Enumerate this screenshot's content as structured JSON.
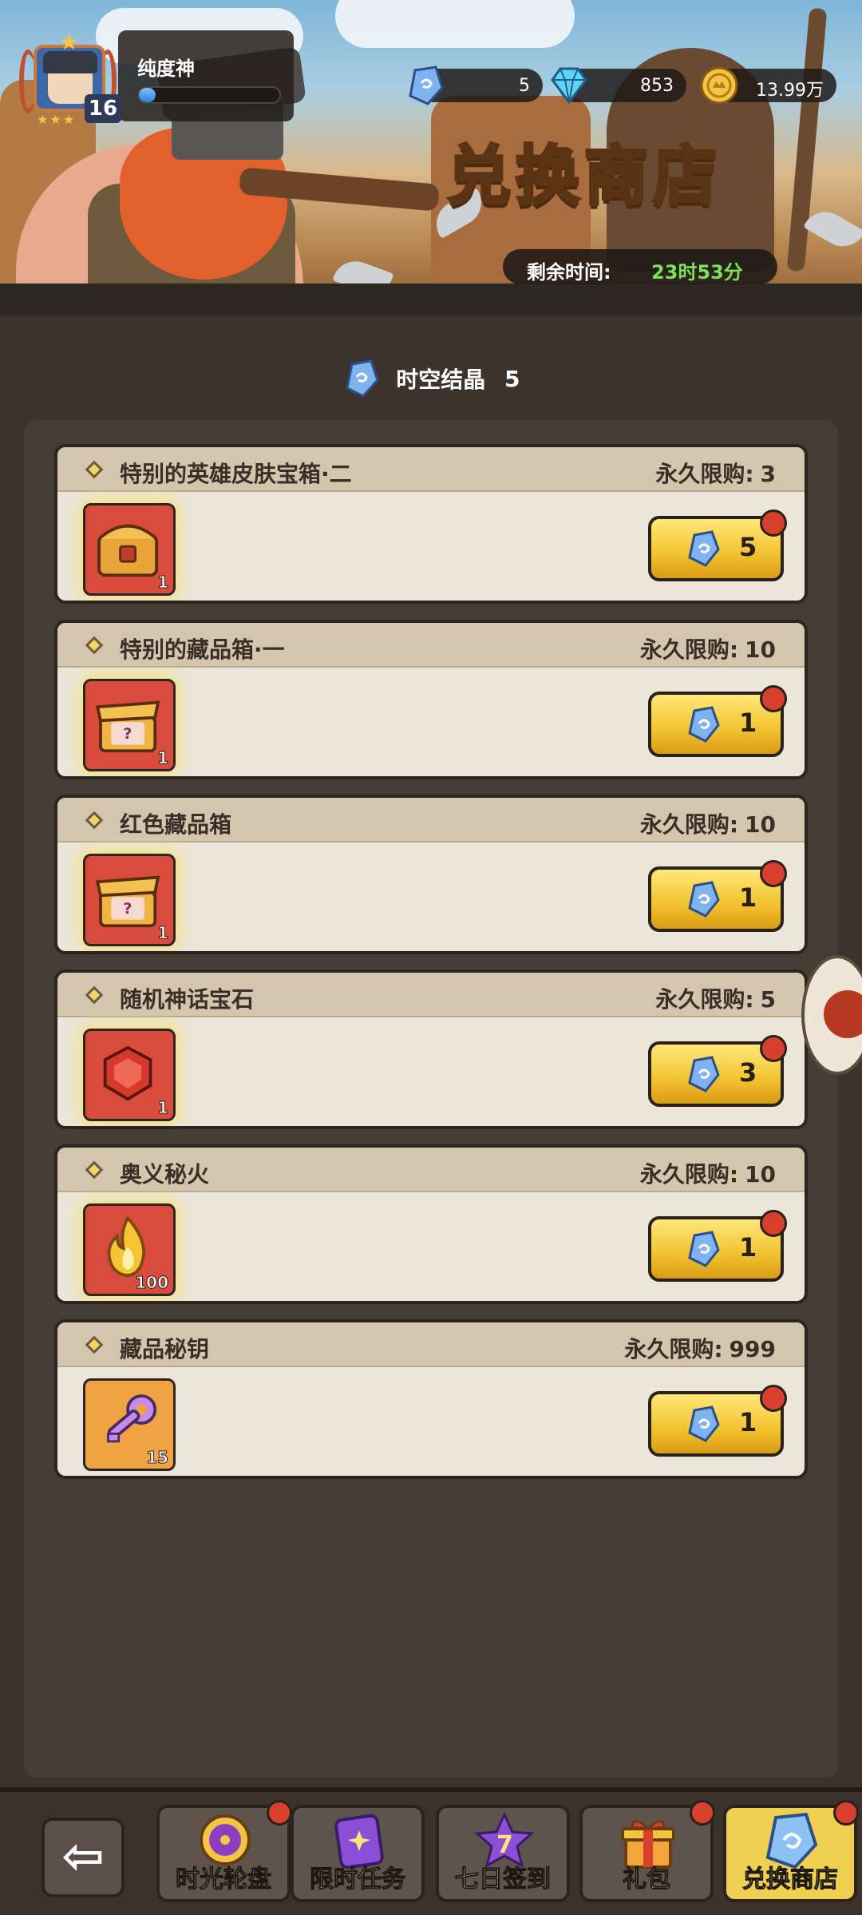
{
  "player": {
    "name": "纯度神",
    "level": "16",
    "xp_fraction": 0.12
  },
  "currencies": [
    {
      "icon": "time-crystal-icon",
      "value": "5"
    },
    {
      "icon": "diamond-icon",
      "value": "853"
    },
    {
      "icon": "gold-coin-icon",
      "value": "13.99万"
    }
  ],
  "shop": {
    "title": "兑换商店",
    "timer_label": "剩余时间:",
    "timer_value": "23时53分"
  },
  "currency_header": {
    "label": "时空结晶",
    "value": "5"
  },
  "items": [
    {
      "name": "特别的英雄皮肤宝箱·二",
      "limit_label": "永久限购:",
      "limit_value": "3",
      "count": "1",
      "price": "5",
      "icon": "hero-skin-chest-icon",
      "frame": "red"
    },
    {
      "name": "特别的藏品箱·一",
      "limit_label": "永久限购:",
      "limit_value": "10",
      "count": "1",
      "price": "1",
      "icon": "collection-chest-icon",
      "frame": "red"
    },
    {
      "name": "红色藏品箱",
      "limit_label": "永久限购:",
      "limit_value": "10",
      "count": "1",
      "price": "1",
      "icon": "red-collection-chest-icon",
      "frame": "red"
    },
    {
      "name": "随机神话宝石",
      "limit_label": "永久限购:",
      "limit_value": "5",
      "count": "1",
      "price": "3",
      "icon": "ruby-gem-icon",
      "frame": "red"
    },
    {
      "name": "奥义秘火",
      "limit_label": "永久限购:",
      "limit_value": "10",
      "count": "100",
      "price": "1",
      "icon": "golden-flame-icon",
      "frame": "red"
    },
    {
      "name": "藏品秘钥",
      "limit_label": "永久限购:",
      "limit_value": "999",
      "count": "15",
      "price": "1",
      "icon": "purple-key-icon",
      "frame": "orange"
    }
  ],
  "tabs": [
    {
      "label": "时光轮盘",
      "icon": "wheel-icon",
      "active": false,
      "dot": true
    },
    {
      "label": "限时任务",
      "icon": "task-card-icon",
      "active": false,
      "dot": false
    },
    {
      "label": "七日签到",
      "icon": "seven-star-icon",
      "active": false,
      "dot": false
    },
    {
      "label": "礼包",
      "icon": "gift-box-icon",
      "active": false,
      "dot": true
    },
    {
      "label": "兑换商店",
      "icon": "crystal-shop-icon",
      "active": true,
      "dot": true
    }
  ],
  "colors": {
    "accent_gold": "#f2c22e",
    "timer_green": "#7fe05a",
    "badge_red": "#d6402d"
  }
}
